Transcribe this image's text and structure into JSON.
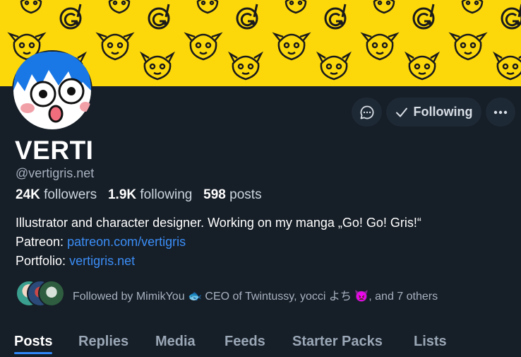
{
  "colors": {
    "banner": "#fcd80b",
    "background": "#161e27",
    "link": "#3b8ef7",
    "muted": "#a7b2c1"
  },
  "header": {
    "message_icon": "chat-bubble-icon",
    "follow_button": {
      "icon": "checkmark-icon",
      "label": "Following"
    },
    "more_icon": "ellipsis-icon"
  },
  "profile": {
    "display_name": "VERTI",
    "handle": "@vertigris.net",
    "stats": {
      "followers_count": "24K",
      "followers_label": "followers",
      "following_count": "1.9K",
      "following_label": "following",
      "posts_count": "598",
      "posts_label": "posts"
    },
    "bio": {
      "line1": "Illustrator and character designer. Working on my manga „Go! Go! Gris!“",
      "patreon_label": "Patreon:",
      "patreon_link": "patreon.com/vertigris",
      "portfolio_label": "Portfolio:",
      "portfolio_link": "vertigris.net"
    },
    "followed_by": {
      "prefix": "Followed by MimikYou",
      "emoji1": "🐟",
      "middle": " CEO of Twintussy, yocci よち",
      "emoji2": "👿",
      "suffix": ", and 7 others"
    }
  },
  "tabs": [
    {
      "label": "Posts",
      "active": true
    },
    {
      "label": "Replies"
    },
    {
      "label": "Media"
    },
    {
      "label": "Feeds"
    },
    {
      "label": "Starter Packs"
    },
    {
      "label": "Lists"
    }
  ]
}
